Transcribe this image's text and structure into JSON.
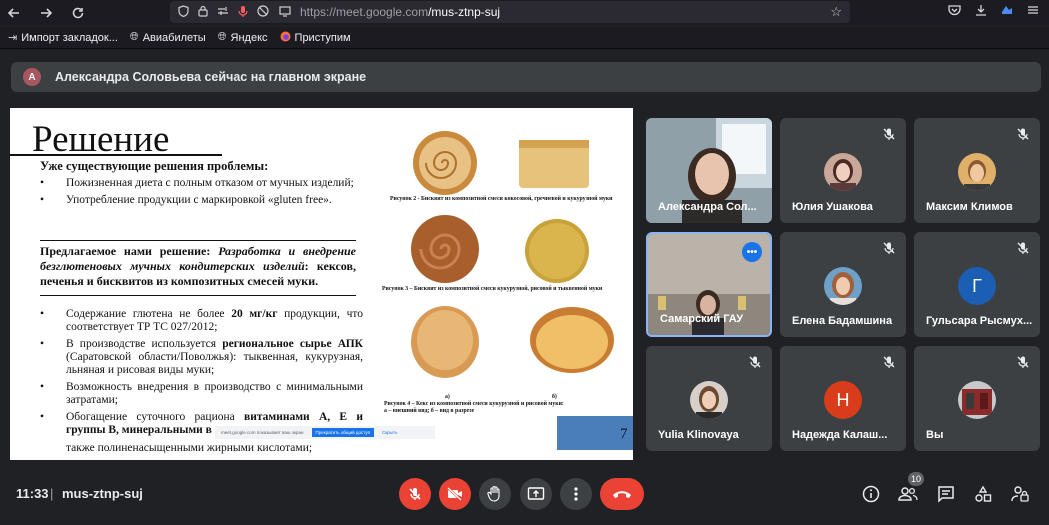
{
  "browser": {
    "url_domain": "https://meet.google.com",
    "url_path": "/mus-ztnp-suj",
    "bookmarks": [
      "Импорт закладок...",
      "Авиабилеты",
      "Яндекс",
      "Приступим"
    ]
  },
  "banner": {
    "avatar_letter": "А",
    "text": "Александра Соловьева сейчас на главном экране"
  },
  "slide": {
    "title": "Решение",
    "existing_heading": "Уже существующие решения проблемы:",
    "existing_items": [
      "Пожизненная диета с полным отказом от мучных изделий;",
      "Употребление продукции с маркировкой «gluten free»."
    ],
    "proposal_lead": "Предлагаемое нами решение:",
    "proposal_italic": "Разработка и внедрение безглютеновых мучных кондитерских изделий",
    "proposal_tail": ": кексов, печенья и бисквитов из композитных смесей муки.",
    "benefits": [
      {
        "pre": "Содержание глютена не более ",
        "bold": "20 мг/кг",
        "post": " продукции, что соответствует ТР ТС 027/2012;"
      },
      {
        "pre": "В производстве используется ",
        "bold": "региональное сырье АПК",
        "post": " (Саратовской области/Поволжья): тыквенная, кукурузная, льняная и рисовая виды муки;"
      },
      {
        "pre": "Возможность внедрения в производство с минимальными затратами;",
        "bold": "",
        "post": ""
      },
      {
        "pre": "Обогащение суточного рациона ",
        "bold": "витаминами А, Е и группы В, минеральными в",
        "post": ""
      }
    ],
    "benefit_tail": "также полиненасыщенными жирными кислотами;",
    "caption2": "Рисунок 2 - Бисквит из композитной смеси кокосовой, гречневой и кукурузной муки",
    "caption3": "Рисунок 3 – Бисквит из композитной смеси кукурузной, рисовой и тыквенной муки",
    "label_a": "а)",
    "label_b": "б)",
    "caption4_line1": "Рисунок 4 – Кекс из композитной смеси кукурузной и рисовой муки:",
    "caption4_line2": "а – внешний вид; б – вид в разрезе",
    "page_number": "7",
    "popup_text": "meet.google.com показывает ваш экран",
    "popup_button": "Прекратить общий доступ",
    "popup_link": "Скрыть"
  },
  "participants": [
    {
      "name": "Александра Сол...",
      "kind": "video",
      "muted": false
    },
    {
      "name": "Юлия Ушакова",
      "kind": "photo",
      "muted": true,
      "color": "#6b4a40"
    },
    {
      "name": "Максим Климов",
      "kind": "photo",
      "muted": true,
      "color": "#d9a86a"
    },
    {
      "name": "Самарский ГАУ",
      "kind": "video",
      "muted": false,
      "active": true
    },
    {
      "name": "Елена Бадамшина",
      "kind": "photo",
      "muted": true,
      "color": "#b07a5a"
    },
    {
      "name": "Гульсара Рысмух...",
      "kind": "letter",
      "muted": true,
      "letter": "Г",
      "color": "#1a5fb4"
    },
    {
      "name": "Yulia Klinovaya",
      "kind": "photo",
      "muted": true,
      "color": "#8a6a50"
    },
    {
      "name": "Надежда Калаш...",
      "kind": "letter",
      "muted": true,
      "letter": "Н",
      "color": "#d93c1b"
    },
    {
      "name": "Вы",
      "kind": "photo",
      "muted": true,
      "color": "#8a2a2a"
    }
  ],
  "bottom": {
    "time": "11:33",
    "separator": "|",
    "meeting_code": "mus-ztnp-suj",
    "participants_count": "10"
  },
  "colors": {
    "meet_bg": "#202124",
    "tile_bg": "#3c4043",
    "danger": "#ea4335",
    "accent": "#1a73e8"
  }
}
